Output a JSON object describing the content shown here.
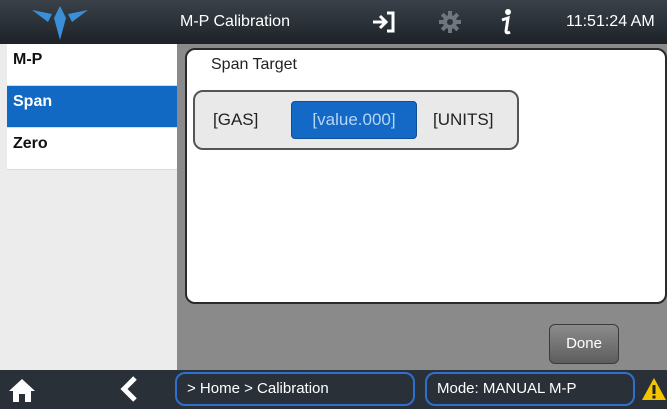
{
  "header": {
    "title": "M-P Calibration",
    "clock": "11:51:24 AM",
    "icons": [
      "logo",
      "login-icon",
      "gear-icon",
      "info-icon"
    ]
  },
  "sidebar": {
    "items": [
      {
        "label": "M-P",
        "active": false
      },
      {
        "label": "Span",
        "active": true
      },
      {
        "label": "Zero",
        "active": false
      }
    ]
  },
  "main": {
    "panel_title": "Span Target",
    "gas_label": "[GAS]",
    "value": "[value.000]",
    "units_label": "[UNITS]",
    "done_label": "Done"
  },
  "footer": {
    "breadcrumb": "> Home > Calibration",
    "mode": "Mode: MANUAL M-P",
    "icons": [
      "home-icon",
      "back-icon",
      "warning-icon"
    ]
  },
  "colors": {
    "accent": "#1269c3",
    "header_bg": "#2c3239",
    "warning": "#f5c400"
  }
}
